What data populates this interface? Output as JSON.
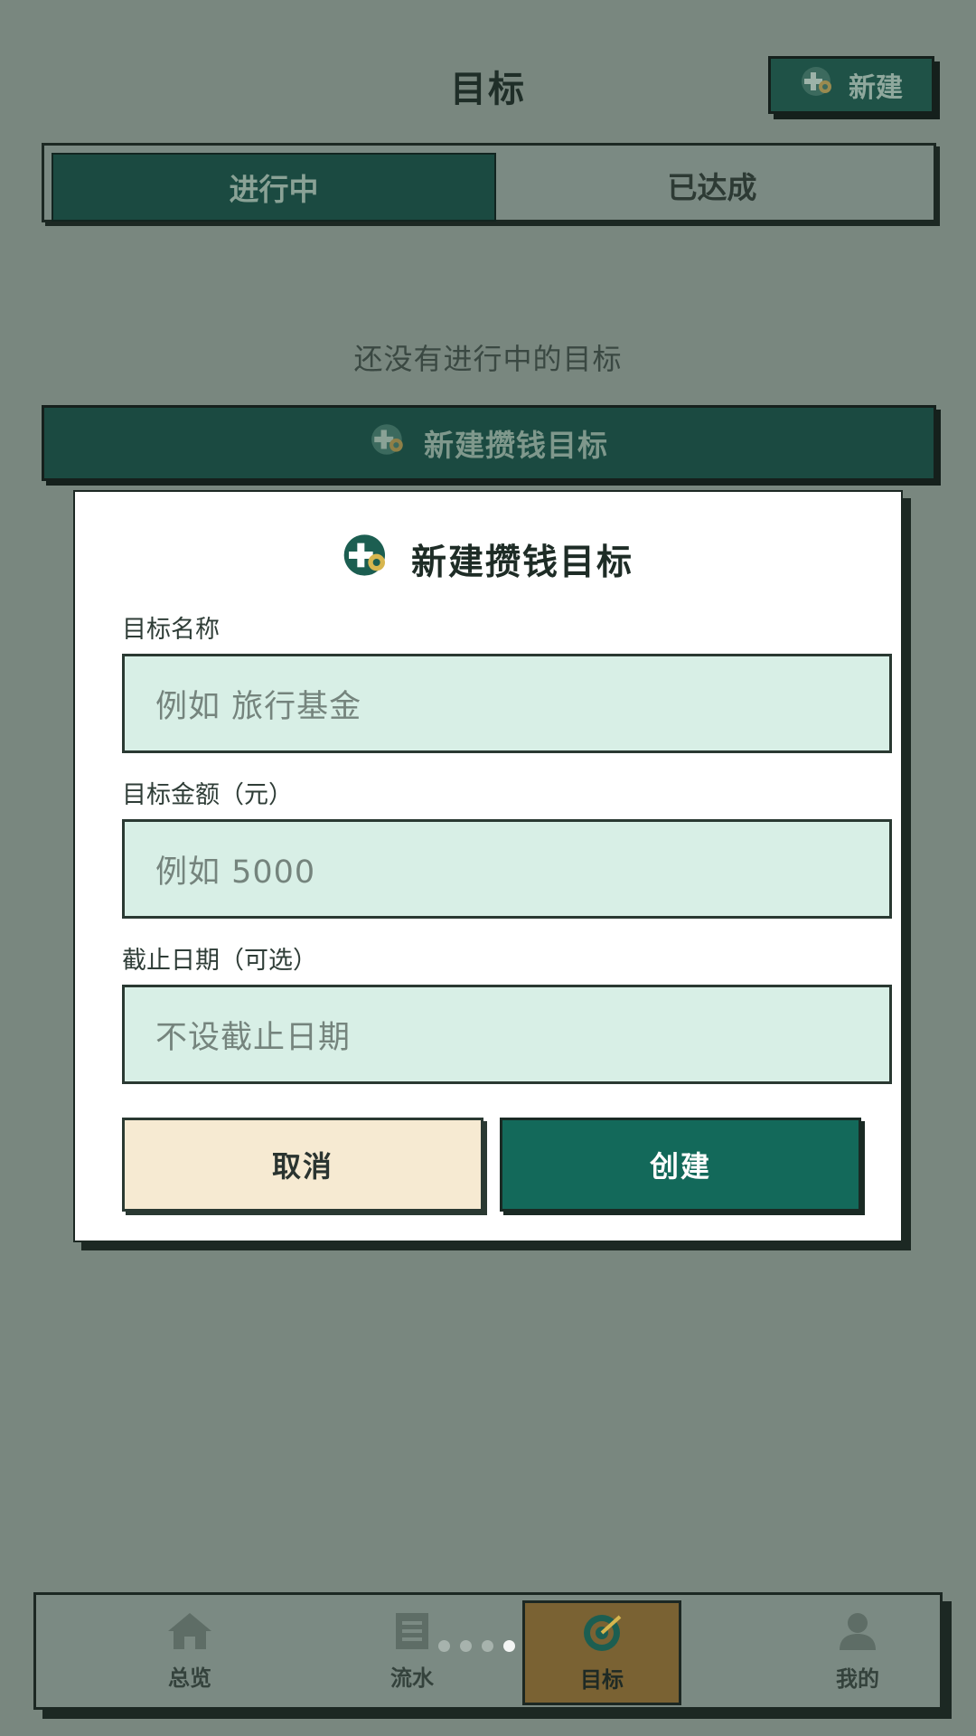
{
  "header": {
    "title": "目标",
    "new_button_label": "新建"
  },
  "tabs": [
    {
      "label": "进行中",
      "active": true
    },
    {
      "label": "已达成",
      "active": false
    }
  ],
  "empty_message": "还没有进行中的目标",
  "create_goal_button_label": "新建攒钱目标",
  "modal": {
    "title": "新建攒钱目标",
    "fields": [
      {
        "label": "目标名称",
        "placeholder": "例如  旅行基金"
      },
      {
        "label": "目标金额（元）",
        "placeholder": "例如  5000"
      },
      {
        "label": "截止日期（可选）",
        "placeholder": "不设截止日期"
      }
    ],
    "cancel_label": "取消",
    "create_label": "创建"
  },
  "bottom_nav": {
    "items": [
      {
        "label": "总览",
        "icon": "home-icon",
        "active": false
      },
      {
        "label": "流水",
        "icon": "ledger-icon",
        "active": false
      },
      {
        "label": "目标",
        "icon": "target-icon",
        "active": true
      },
      {
        "label": "我的",
        "icon": "user-icon",
        "active": false
      }
    ],
    "page_indicator": {
      "count": 5,
      "current": 4
    }
  },
  "colors": {
    "background": "#79877f",
    "primary_dark_green": "#1b4a41",
    "create_button_green": "#13695a",
    "input_fill": "#d8efe6",
    "cancel_fill": "#f6ead2",
    "nav_active": "#7a6233"
  }
}
